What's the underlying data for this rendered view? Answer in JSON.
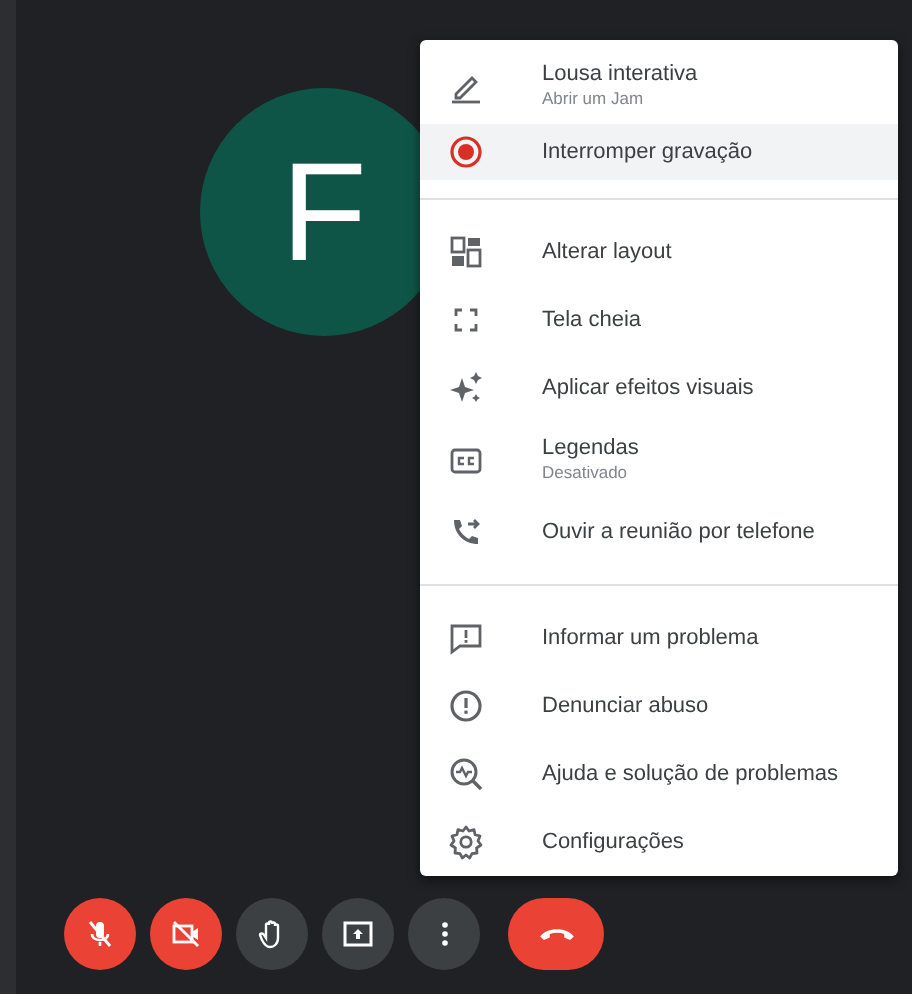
{
  "participant": {
    "initial": "F"
  },
  "menu": {
    "sections": [
      {
        "items": [
          {
            "kind": "whiteboard",
            "label": "Lousa interativa",
            "sublabel": "Abrir um Jam",
            "selected": false
          },
          {
            "kind": "record",
            "label": "Interromper gravação",
            "selected": true
          }
        ]
      },
      {
        "items": [
          {
            "kind": "layout",
            "label": "Alterar layout",
            "selected": false
          },
          {
            "kind": "fullscreen",
            "label": "Tela cheia",
            "selected": false
          },
          {
            "kind": "effects",
            "label": "Aplicar efeitos visuais",
            "selected": false
          },
          {
            "kind": "captions",
            "label": "Legendas",
            "sublabel": "Desativado",
            "selected": false
          },
          {
            "kind": "phone",
            "label": "Ouvir a reunião por telefone",
            "selected": false
          }
        ]
      },
      {
        "items": [
          {
            "kind": "feedback",
            "label": "Informar um problema",
            "selected": false
          },
          {
            "kind": "alert",
            "label": "Denunciar abuso",
            "selected": false
          },
          {
            "kind": "help",
            "label": "Ajuda e solução de problemas",
            "selected": false
          },
          {
            "kind": "settings",
            "label": "Configurações",
            "selected": false
          }
        ]
      }
    ]
  },
  "controls": [
    {
      "kind": "mic",
      "off": true
    },
    {
      "kind": "camera",
      "off": true
    },
    {
      "kind": "hand",
      "off": false
    },
    {
      "kind": "present"
    },
    {
      "kind": "more"
    },
    {
      "kind": "hangup"
    }
  ]
}
